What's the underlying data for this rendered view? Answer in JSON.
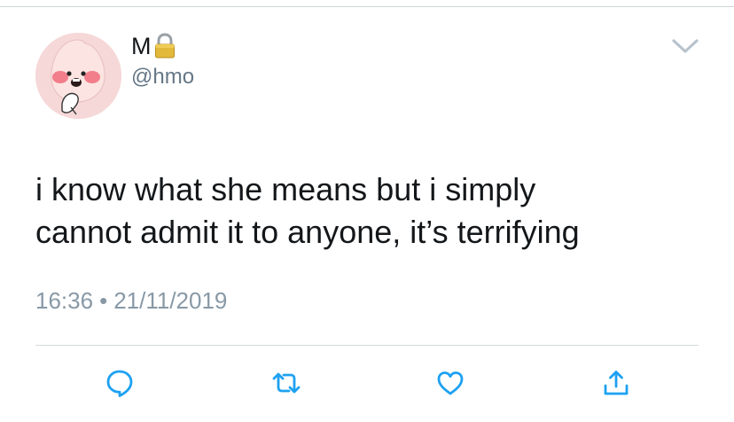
{
  "user": {
    "display_name": "M",
    "handle": "@hmo",
    "verified_lock": "lock-icon",
    "avatar": "peach-character-avatar"
  },
  "tweet": {
    "text_line1": "i know what she means but i simply",
    "text_line2": "cannot admit it to anyone, it’s terrifying",
    "time": "16:36",
    "separator": "•",
    "date": "21/11/2019"
  },
  "actions": {
    "reply_icon": "reply-icon",
    "retweet_icon": "retweet-icon",
    "like_icon": "heart-icon",
    "share_icon": "share-icon"
  },
  "colors": {
    "text": "#14171a",
    "muted": "#657786",
    "meta": "#8899a6",
    "icon": "#1da1f2",
    "divider": "#d6dade"
  }
}
